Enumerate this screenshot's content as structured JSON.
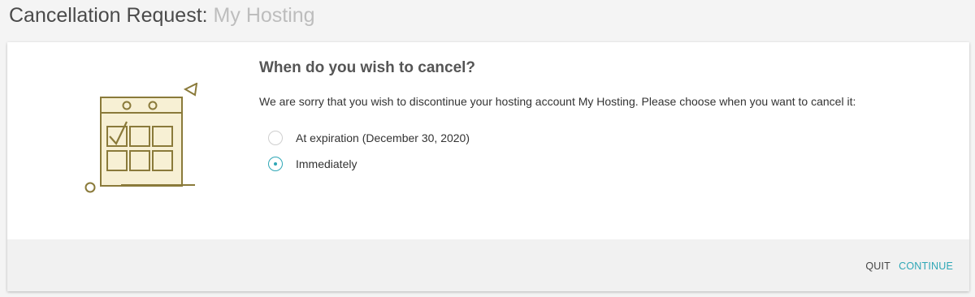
{
  "header": {
    "title": "Cancellation Request:",
    "subtitle": "My Hosting"
  },
  "main": {
    "question": "When do you wish to cancel?",
    "description": "We are sorry that you wish to discontinue your hosting account My Hosting. Please choose when you want to cancel it:",
    "options": [
      {
        "label": "At expiration (December 30, 2020)",
        "selected": false
      },
      {
        "label": "Immediately",
        "selected": true
      }
    ]
  },
  "illustration": {
    "icon": "calendar-check-icon",
    "stroke_color": "#8a7a3a",
    "fill_color": "#f7f0d4"
  },
  "footer": {
    "quit_label": "QUIT",
    "continue_label": "CONTINUE"
  },
  "colors": {
    "accent": "#2fa7b6",
    "text": "#333333",
    "muted_title": "#bdbdbd"
  }
}
